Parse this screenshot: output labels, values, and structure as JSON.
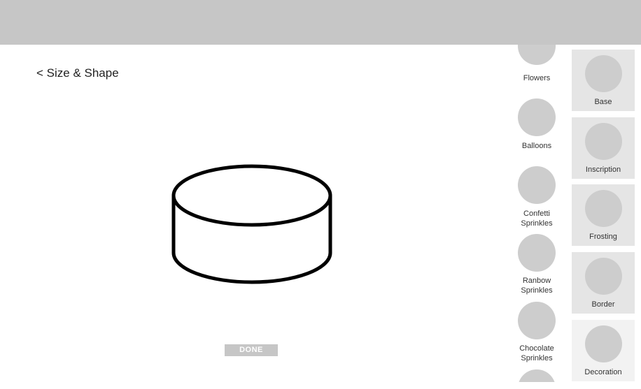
{
  "nav": {
    "back_label": "< Size & Shape"
  },
  "actions": {
    "done_label": "DONE"
  },
  "toppings": [
    {
      "label": "Flowers"
    },
    {
      "label": "Balloons"
    },
    {
      "label": "Confetti Sprinkles"
    },
    {
      "label": "Ranbow Sprinkles"
    },
    {
      "label": "Chocolate Sprinkles"
    },
    {
      "label": ""
    }
  ],
  "categories": [
    {
      "label": "Base"
    },
    {
      "label": "Inscription"
    },
    {
      "label": "Frosting"
    },
    {
      "label": "Border"
    },
    {
      "label": "Decoration",
      "selected": true
    }
  ]
}
